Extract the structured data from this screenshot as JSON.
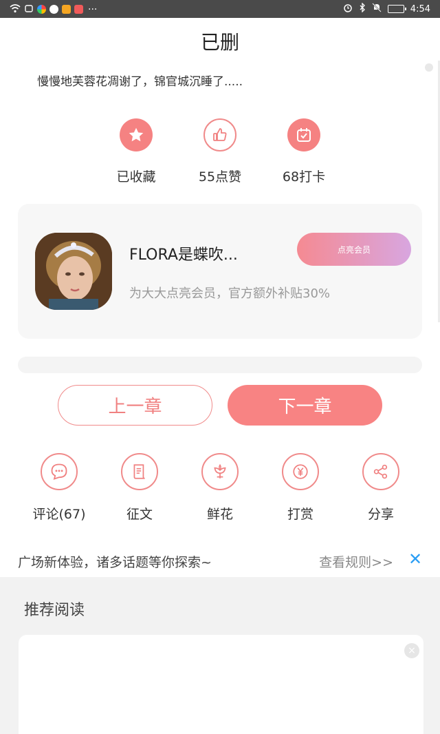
{
  "status_bar": {
    "time": "4:54",
    "more": "···"
  },
  "article": {
    "title": "已删",
    "excerpt": "慢慢地芙蓉花凋谢了，锦官城沉睡了....."
  },
  "stats": [
    {
      "label": "已收藏",
      "icon": "star-icon"
    },
    {
      "label": "55点赞",
      "icon": "thumbs-up-icon"
    },
    {
      "label": "68打卡",
      "icon": "calendar-check-icon"
    }
  ],
  "member": {
    "name": "FLORA是蝶吹...",
    "button_label": "点亮会员",
    "description": "为大大点亮会员，官方额外补贴30%"
  },
  "chapter_nav": {
    "prev_label": "上一章",
    "next_label": "下一章"
  },
  "actions": [
    {
      "label": "评论(67)",
      "icon": "comment-icon"
    },
    {
      "label": "征文",
      "icon": "scroll-icon"
    },
    {
      "label": "鲜花",
      "icon": "flower-icon"
    },
    {
      "label": "打赏",
      "icon": "yen-icon"
    },
    {
      "label": "分享",
      "icon": "share-icon"
    }
  ],
  "plaza": {
    "text": "广场新体验，诸多话题等你探索~",
    "rules_link": "查看规则>>",
    "close": "✕"
  },
  "recommend": {
    "title": "推荐阅读",
    "close": "×"
  },
  "colors": {
    "accent": "#f88383",
    "link_blue": "#2a9df4"
  }
}
